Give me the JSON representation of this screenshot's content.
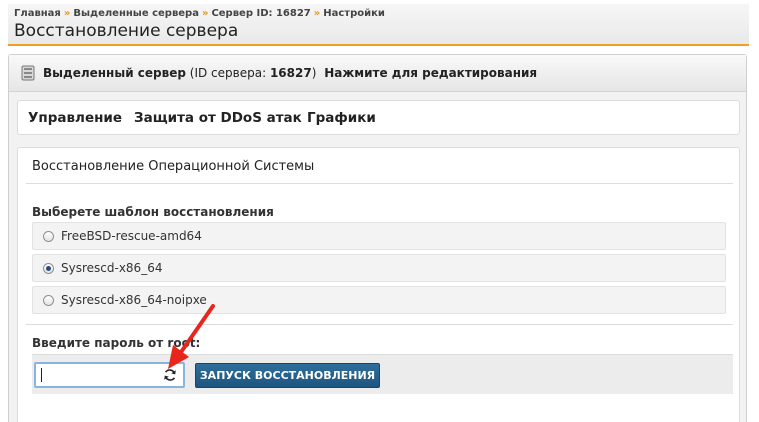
{
  "breadcrumb": {
    "items": [
      "Главная",
      "Выделенные сервера",
      "Сервер ID: 16827",
      "Настройки"
    ],
    "separator": "»"
  },
  "page": {
    "title": "Восстановление сервера"
  },
  "server_panel": {
    "label": "Выделенный сервер",
    "id_prefix": "(ID сервера:",
    "id_value": "16827",
    "id_suffix": ")",
    "edit_link": "Нажмите для редактирования",
    "icon": "server-icon"
  },
  "tabs": [
    {
      "label": "Управление"
    },
    {
      "label": "Защита от DDoS атак"
    },
    {
      "label": "Графики"
    }
  ],
  "restore": {
    "title": "Восстановление Операционной Системы",
    "template_label": "Выберете шаблон восстановления",
    "options": [
      {
        "label": "FreeBSD-rescue-amd64",
        "checked": false
      },
      {
        "label": "Sysrescd-x86_64",
        "checked": true
      },
      {
        "label": "Sysrescd-x86_64-noipxe",
        "checked": false
      }
    ],
    "password_label": "Введите пароль от root:",
    "password_value": "",
    "refresh_icon": "refresh-icon",
    "start_button": "ЗАПУСК ВОССТАНОВЛЕНИЯ"
  },
  "colors": {
    "accent": "#f0a020",
    "button": "#23608b",
    "arrow": "#e8261c",
    "input_focus": "#89b4e0"
  }
}
